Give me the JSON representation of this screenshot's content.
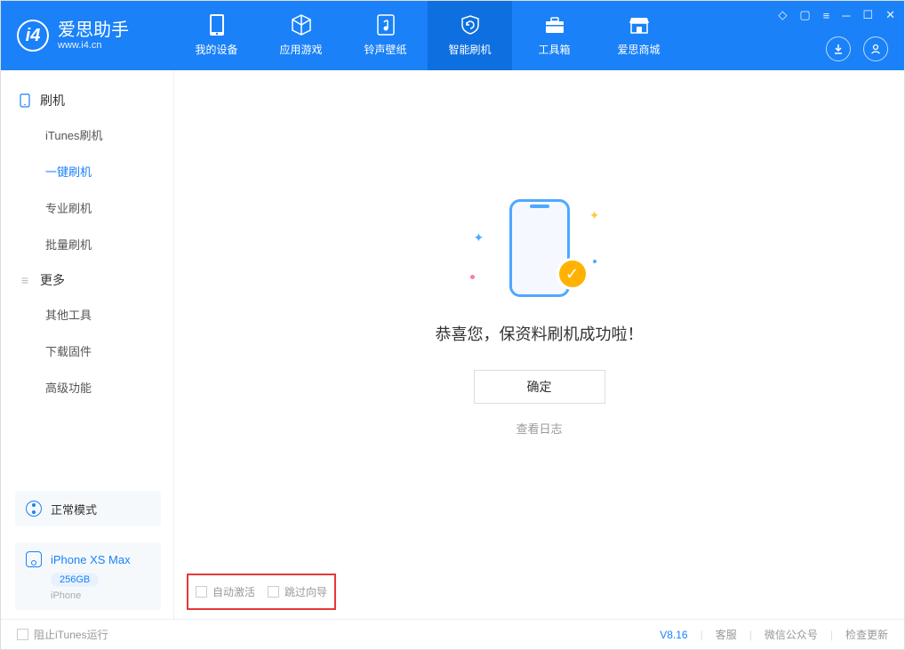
{
  "app": {
    "title": "爱思助手",
    "subtitle": "www.i4.cn"
  },
  "tabs": [
    {
      "label": "我的设备"
    },
    {
      "label": "应用游戏"
    },
    {
      "label": "铃声壁纸"
    },
    {
      "label": "智能刷机"
    },
    {
      "label": "工具箱"
    },
    {
      "label": "爱思商城"
    }
  ],
  "sidebar": {
    "group1": {
      "title": "刷机"
    },
    "items1": [
      {
        "label": "iTunes刷机"
      },
      {
        "label": "一键刷机"
      },
      {
        "label": "专业刷机"
      },
      {
        "label": "批量刷机"
      }
    ],
    "group2": {
      "title": "更多"
    },
    "items2": [
      {
        "label": "其他工具"
      },
      {
        "label": "下载固件"
      },
      {
        "label": "高级功能"
      }
    ]
  },
  "mode": {
    "label": "正常模式"
  },
  "device": {
    "name": "iPhone XS Max",
    "storage": "256GB",
    "type": "iPhone"
  },
  "main": {
    "success_text": "恭喜您，保资料刷机成功啦！",
    "confirm": "确定",
    "view_log": "查看日志"
  },
  "bottom_opts": {
    "auto_activate": "自动激活",
    "skip_guide": "跳过向导"
  },
  "footer": {
    "block_itunes": "阻止iTunes运行",
    "version": "V8.16",
    "service": "客服",
    "wechat": "微信公众号",
    "update": "检查更新"
  }
}
